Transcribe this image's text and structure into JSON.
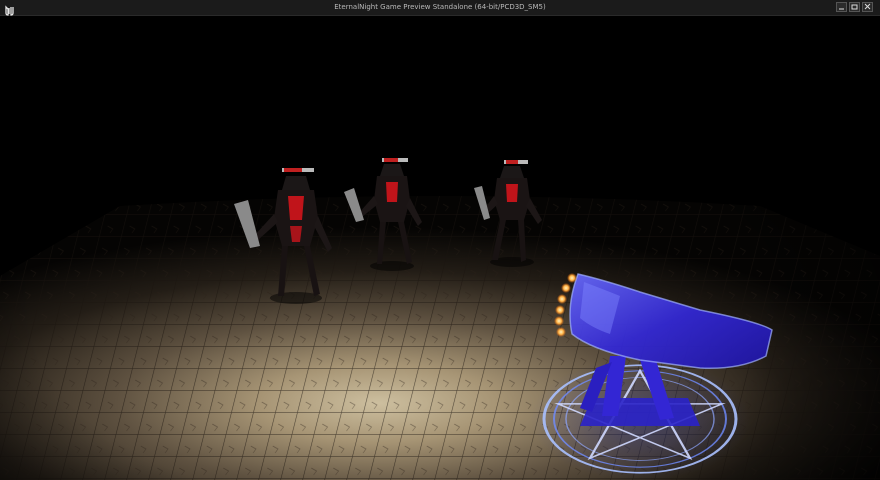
{
  "window": {
    "title": "EternalNight Game Preview Standalone (64-bit/PCD3D_SM5)",
    "logo_icon": "unreal-engine-logo-icon",
    "controls": [
      "minimize-icon",
      "restore-icon",
      "close-icon"
    ]
  },
  "scene": {
    "enemies": [
      "dark-knight-enemy",
      "dark-knight-enemy",
      "dark-knight-enemy"
    ],
    "tower": "spectral-cannon-tower",
    "summoning_circle": "pentagram-circle",
    "colors": {
      "floor": "#9a8a6c",
      "enemy_armor": "#1a1414",
      "enemy_accent": "#c0141a",
      "tower_blue": "#3a2fe0",
      "tower_glow": "#9fb0ff",
      "flame": "#ffb347"
    }
  }
}
